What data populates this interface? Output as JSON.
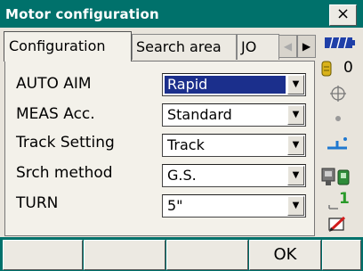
{
  "window": {
    "title": "Motor configuration",
    "close_label": "×"
  },
  "tabs": [
    {
      "label": "Configuration",
      "active": true
    },
    {
      "label": "Search area",
      "active": false
    },
    {
      "label": "JO",
      "active": false
    }
  ],
  "tab_scroll": {
    "left": "◀",
    "right": "▶"
  },
  "fields": [
    {
      "label": "AUTO AIM",
      "value": "Rapid",
      "selected": true
    },
    {
      "label": "MEAS Acc.",
      "value": "Standard",
      "selected": false
    },
    {
      "label": "Track Setting",
      "value": "Track",
      "selected": false
    },
    {
      "label": "Srch method",
      "value": "G.S.",
      "selected": false
    },
    {
      "label": "TURN",
      "value": "5\"",
      "selected": false
    }
  ],
  "sidebar": {
    "battery_icon": "battery-icon",
    "prism_constant": "0",
    "prism_icon": "prism-icon",
    "target_icon": "crosshair-icon",
    "dot_icon": "dot-icon",
    "tilt_icon": "tilt-icon",
    "instrument_icon": "instrument-icon",
    "signal_value": "1",
    "edit_icon": "edit-icon"
  },
  "softkeys": [
    "",
    "",
    "",
    "",
    "OK",
    ""
  ],
  "colors": {
    "titlebar": "#00716b",
    "selection": "#1b2f8c"
  }
}
